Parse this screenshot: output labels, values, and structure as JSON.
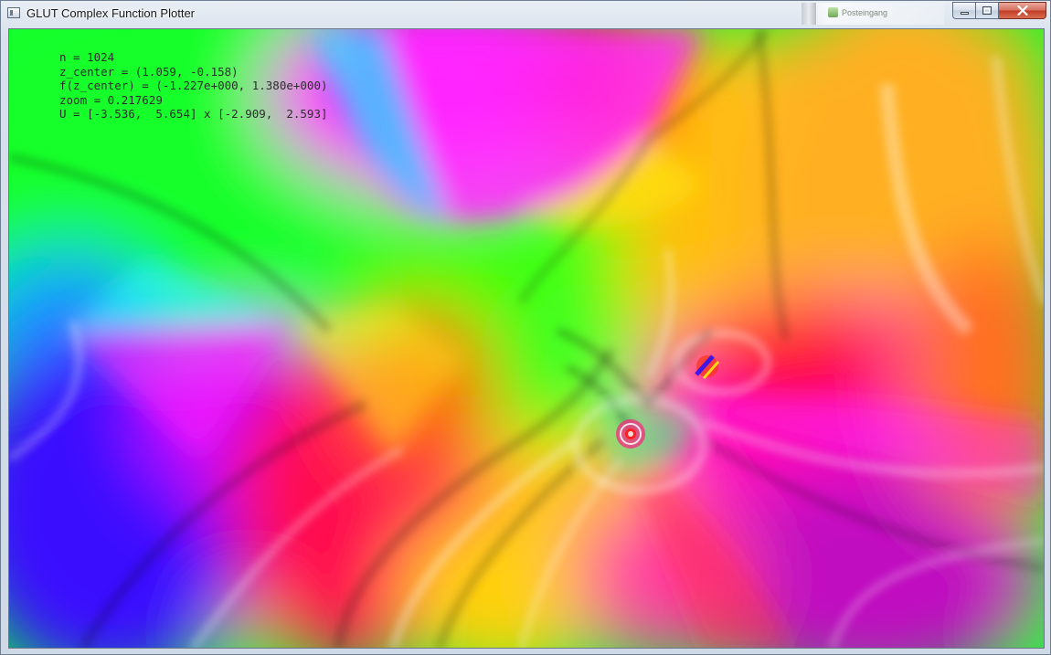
{
  "window": {
    "title": "GLUT Complex Function Plotter",
    "icon": "app-window-icon",
    "buttons": {
      "minimize": "minimize-icon",
      "maximize": "maximize-icon",
      "close": "close-icon"
    }
  },
  "background_window": {
    "label": "Posteingang"
  },
  "overlay": {
    "lines": [
      "n = 1024",
      "z_center = (1.059, -0.158)",
      "f(z_center) = (-1.227e+000, 1.380e+000)",
      "zoom = 0.217629",
      "U = [-3.536,  5.654] x [-2.909,  2.593]"
    ]
  },
  "colors": {
    "green": "#00ff33",
    "magenta": "#ff00ff",
    "blue": "#2d00ff",
    "red": "#ff1a1a",
    "yellow": "#ffe000",
    "orange": "#ffa51a",
    "cyan": "#00ffff"
  }
}
